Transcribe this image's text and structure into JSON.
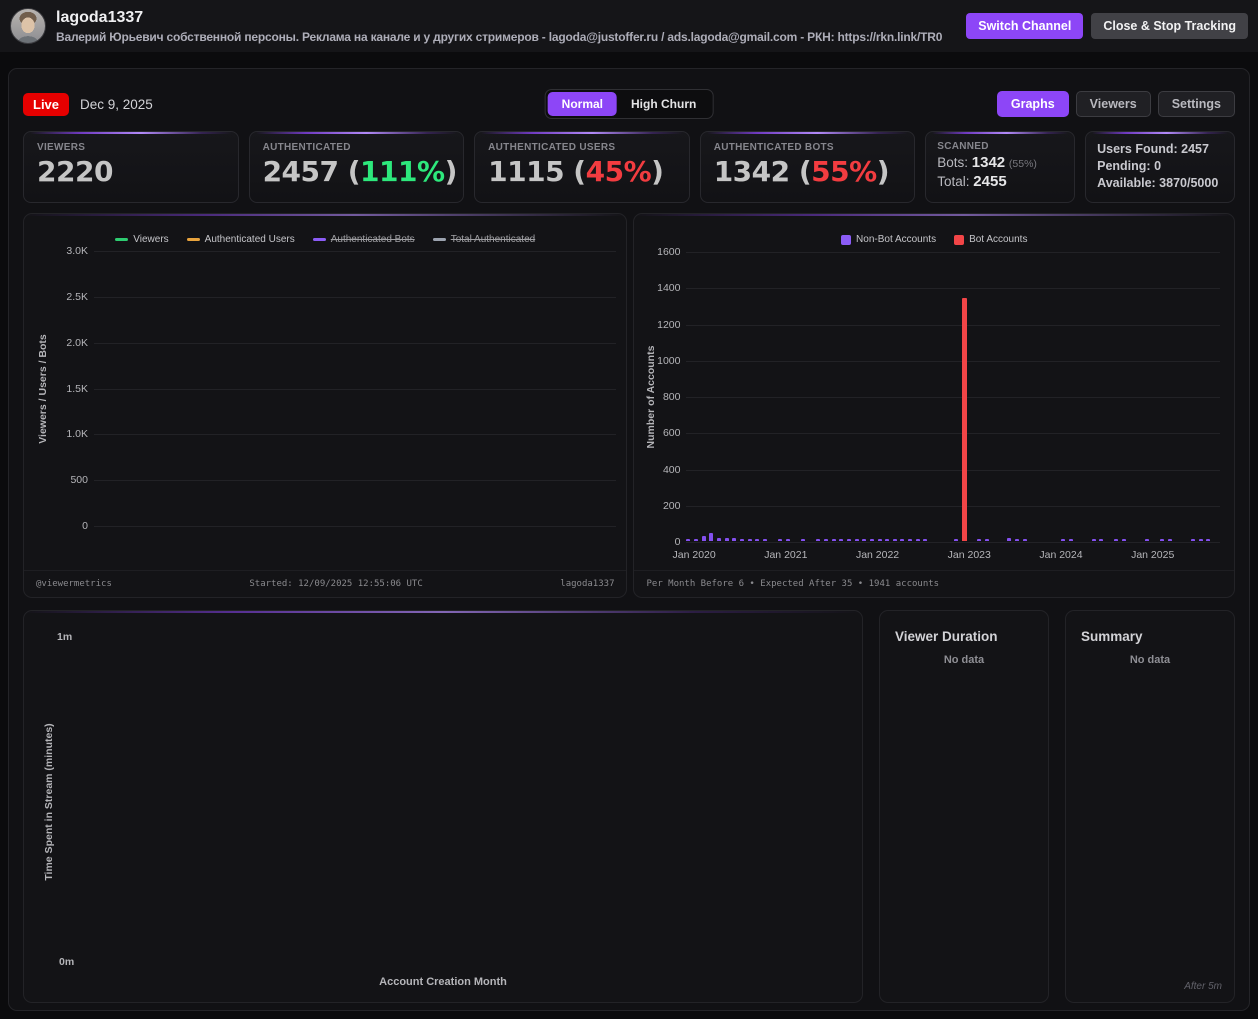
{
  "header": {
    "username": "lagoda1337",
    "subtitle": "Валерий Юрьевич собственной персоны. Реклама на канале и у других стримеров - lagoda@justoffer.ru / ads.lagoda@gmail.com  -   РКН: https://rkn.link/TR0",
    "switch_channel": "Switch Channel",
    "close_stop": "Close & Stop Tracking"
  },
  "toolbar": {
    "live": "Live",
    "date": "Dec 9, 2025",
    "mode_normal": "Normal",
    "mode_high_churn": "High Churn",
    "tab_graphs": "Graphs",
    "tab_viewers": "Viewers",
    "tab_settings": "Settings"
  },
  "stat_cards": [
    {
      "label": "VIEWERS",
      "value": "2220",
      "percent": null,
      "percent_color": null
    },
    {
      "label": "AUTHENTICATED",
      "value": "2457",
      "percent": "111%",
      "percent_color": "green"
    },
    {
      "label": "AUTHENTICATED USERS",
      "value": "1115",
      "percent": "45%",
      "percent_color": "red"
    },
    {
      "label": "AUTHENTICATED BOTS",
      "value": "1342",
      "percent": "55%",
      "percent_color": "red"
    }
  ],
  "scanned_card": {
    "label": "SCANNED",
    "bots_label": "Bots:",
    "bots_value": "1342",
    "bots_percent": "(55%)",
    "total_label": "Total:",
    "total_value": "2455"
  },
  "quota_card": {
    "lines": [
      "Users Found: 2457",
      "Pending: 0",
      "Available: 3870/5000"
    ]
  },
  "chart_data": [
    {
      "id": "viewers-line",
      "type": "line",
      "ylabel": "Viewers / Users / Bots",
      "yticks": [
        "3.0K",
        "2.5K",
        "2.0K",
        "1.5K",
        "1.0K",
        "500",
        "0"
      ],
      "ylim": [
        0,
        3000
      ],
      "grid": true,
      "legend_position": "top",
      "series": [
        {
          "name": "Viewers",
          "color": "#2ecc71",
          "hidden": false,
          "values": []
        },
        {
          "name": "Authenticated Users",
          "color": "#e8a33d",
          "hidden": false,
          "values": []
        },
        {
          "name": "Authenticated Bots",
          "color": "#8b5cf6",
          "hidden": true,
          "values": []
        },
        {
          "name": "Total Authenticated",
          "color": "#9ca3af",
          "hidden": true,
          "values": []
        }
      ],
      "footer": {
        "left": "@viewermetrics",
        "center": "Started: 12/09/2025 12:55:06 UTC",
        "right": "lagoda1337"
      }
    },
    {
      "id": "account-creation-bars",
      "type": "bar",
      "ylabel": "Number of Accounts",
      "ylim": [
        0,
        1600
      ],
      "yticks": [
        "1600",
        "1400",
        "1200",
        "1000",
        "800",
        "600",
        "400",
        "200",
        "0"
      ],
      "xticks": [
        "Jan 2020",
        "Jan 2021",
        "Jan 2022",
        "Jan 2023",
        "Jan 2024",
        "Jan 2025"
      ],
      "x_start_month": "2019-12",
      "months_total": 70,
      "legend": [
        {
          "name": "Non-Bot Accounts",
          "color": "#8b5cf6"
        },
        {
          "name": "Bot Accounts",
          "color": "#f24547"
        }
      ],
      "series": [
        {
          "name": "Non-Bot Accounts",
          "color": "#8450ef",
          "values": [
            3,
            12,
            30,
            45,
            18,
            14,
            16,
            8,
            8,
            8,
            10,
            0,
            8,
            10,
            0,
            8,
            0,
            10,
            8,
            8,
            8,
            8,
            8,
            10,
            10,
            10,
            12,
            10,
            8,
            8,
            12,
            8,
            0,
            0,
            0,
            10,
            8,
            0,
            8,
            10,
            0,
            0,
            14,
            8,
            8,
            0,
            0,
            0,
            0,
            8,
            8,
            0,
            0,
            8,
            8,
            0,
            8,
            8,
            0,
            0,
            6,
            0,
            8,
            8,
            0,
            0,
            4,
            4,
            4,
            0
          ]
        },
        {
          "name": "Bot Accounts",
          "color": "#f24547",
          "values": [
            0,
            0,
            0,
            0,
            0,
            0,
            0,
            0,
            0,
            0,
            0,
            0,
            0,
            0,
            0,
            0,
            0,
            0,
            0,
            0,
            0,
            0,
            0,
            0,
            0,
            0,
            0,
            0,
            0,
            0,
            0,
            0,
            0,
            0,
            0,
            0,
            1342,
            0,
            0,
            0,
            0,
            0,
            0,
            0,
            0,
            0,
            0,
            0,
            0,
            0,
            0,
            0,
            0,
            0,
            0,
            0,
            0,
            0,
            0,
            0,
            0,
            0,
            0,
            0,
            0,
            0,
            0,
            0,
            0,
            0
          ]
        }
      ],
      "footer": "Per Month Before 6 • Expected After 35 • 1941 accounts"
    },
    {
      "id": "time-in-stream",
      "type": "scatter",
      "ylabel": "Time Spent in Stream (minutes)",
      "xlabel": "Account Creation Month",
      "yticks": [
        "1m",
        "0m"
      ],
      "points": []
    }
  ],
  "side_panels": [
    {
      "title": "Viewer Duration",
      "empty": "No data"
    },
    {
      "title": "Summary",
      "empty": "No data",
      "corner_note": "After 5m"
    }
  ]
}
